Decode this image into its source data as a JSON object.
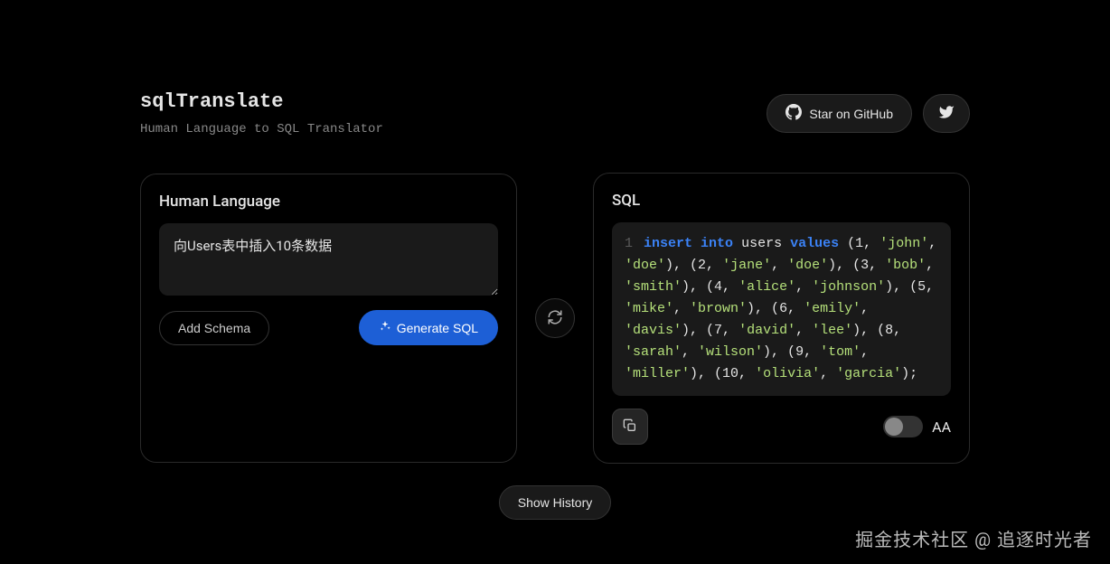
{
  "header": {
    "title": "sqlTranslate",
    "subtitle": "Human Language to SQL Translator",
    "github_label": "Star on GitHub"
  },
  "left_panel": {
    "title": "Human Language",
    "input_value": "向Users表中插入10条数据",
    "add_schema_label": "Add Schema",
    "generate_label": "Generate SQL"
  },
  "right_panel": {
    "title": "SQL",
    "line_num": "1",
    "code_tokens": [
      {
        "t": "kw",
        "v": "insert"
      },
      {
        "t": "sp"
      },
      {
        "t": "kw",
        "v": "into"
      },
      {
        "t": "sp"
      },
      {
        "t": "ident",
        "v": "users"
      },
      {
        "t": "sp"
      },
      {
        "t": "kw",
        "v": "values"
      },
      {
        "t": "sp"
      },
      {
        "t": "punct",
        "v": "("
      },
      {
        "t": "num",
        "v": "1"
      },
      {
        "t": "punct",
        "v": ", "
      },
      {
        "t": "str",
        "v": "'john'"
      },
      {
        "t": "punct",
        "v": ", "
      },
      {
        "t": "str",
        "v": "'doe'"
      },
      {
        "t": "punct",
        "v": "), ("
      },
      {
        "t": "num",
        "v": "2"
      },
      {
        "t": "punct",
        "v": ", "
      },
      {
        "t": "str",
        "v": "'jane'"
      },
      {
        "t": "punct",
        "v": ", "
      },
      {
        "t": "str",
        "v": "'doe'"
      },
      {
        "t": "punct",
        "v": "), ("
      },
      {
        "t": "num",
        "v": "3"
      },
      {
        "t": "punct",
        "v": ", "
      },
      {
        "t": "str",
        "v": "'bob'"
      },
      {
        "t": "punct",
        "v": ", "
      },
      {
        "t": "str",
        "v": "'smith'"
      },
      {
        "t": "punct",
        "v": "), ("
      },
      {
        "t": "num",
        "v": "4"
      },
      {
        "t": "punct",
        "v": ", "
      },
      {
        "t": "str",
        "v": "'alice'"
      },
      {
        "t": "punct",
        "v": ", "
      },
      {
        "t": "str",
        "v": "'johnson'"
      },
      {
        "t": "punct",
        "v": "), ("
      },
      {
        "t": "num",
        "v": "5"
      },
      {
        "t": "punct",
        "v": ", "
      },
      {
        "t": "str",
        "v": "'mike'"
      },
      {
        "t": "punct",
        "v": ", "
      },
      {
        "t": "str",
        "v": "'brown'"
      },
      {
        "t": "punct",
        "v": "), ("
      },
      {
        "t": "num",
        "v": "6"
      },
      {
        "t": "punct",
        "v": ", "
      },
      {
        "t": "str",
        "v": "'emily'"
      },
      {
        "t": "punct",
        "v": ", "
      },
      {
        "t": "str",
        "v": "'davis'"
      },
      {
        "t": "punct",
        "v": "), ("
      },
      {
        "t": "num",
        "v": "7"
      },
      {
        "t": "punct",
        "v": ", "
      },
      {
        "t": "str",
        "v": "'david'"
      },
      {
        "t": "punct",
        "v": ", "
      },
      {
        "t": "str",
        "v": "'lee'"
      },
      {
        "t": "punct",
        "v": "), ("
      },
      {
        "t": "num",
        "v": "8"
      },
      {
        "t": "punct",
        "v": ", "
      },
      {
        "t": "str",
        "v": "'sarah'"
      },
      {
        "t": "punct",
        "v": ", "
      },
      {
        "t": "str",
        "v": "'wilson'"
      },
      {
        "t": "punct",
        "v": "), ("
      },
      {
        "t": "num",
        "v": "9"
      },
      {
        "t": "punct",
        "v": ", "
      },
      {
        "t": "str",
        "v": "'tom'"
      },
      {
        "t": "punct",
        "v": ", "
      },
      {
        "t": "str",
        "v": "'miller'"
      },
      {
        "t": "punct",
        "v": "), ("
      },
      {
        "t": "num",
        "v": "10"
      },
      {
        "t": "punct",
        "v": ", "
      },
      {
        "t": "str",
        "v": "'olivia'"
      },
      {
        "t": "punct",
        "v": ", "
      },
      {
        "t": "str",
        "v": "'garcia'"
      },
      {
        "t": "punct",
        "v": ");"
      }
    ],
    "case_label": "AA"
  },
  "footer": {
    "history_label": "Show History"
  },
  "watermark": "掘金技术社区 @ 追逐时光者"
}
